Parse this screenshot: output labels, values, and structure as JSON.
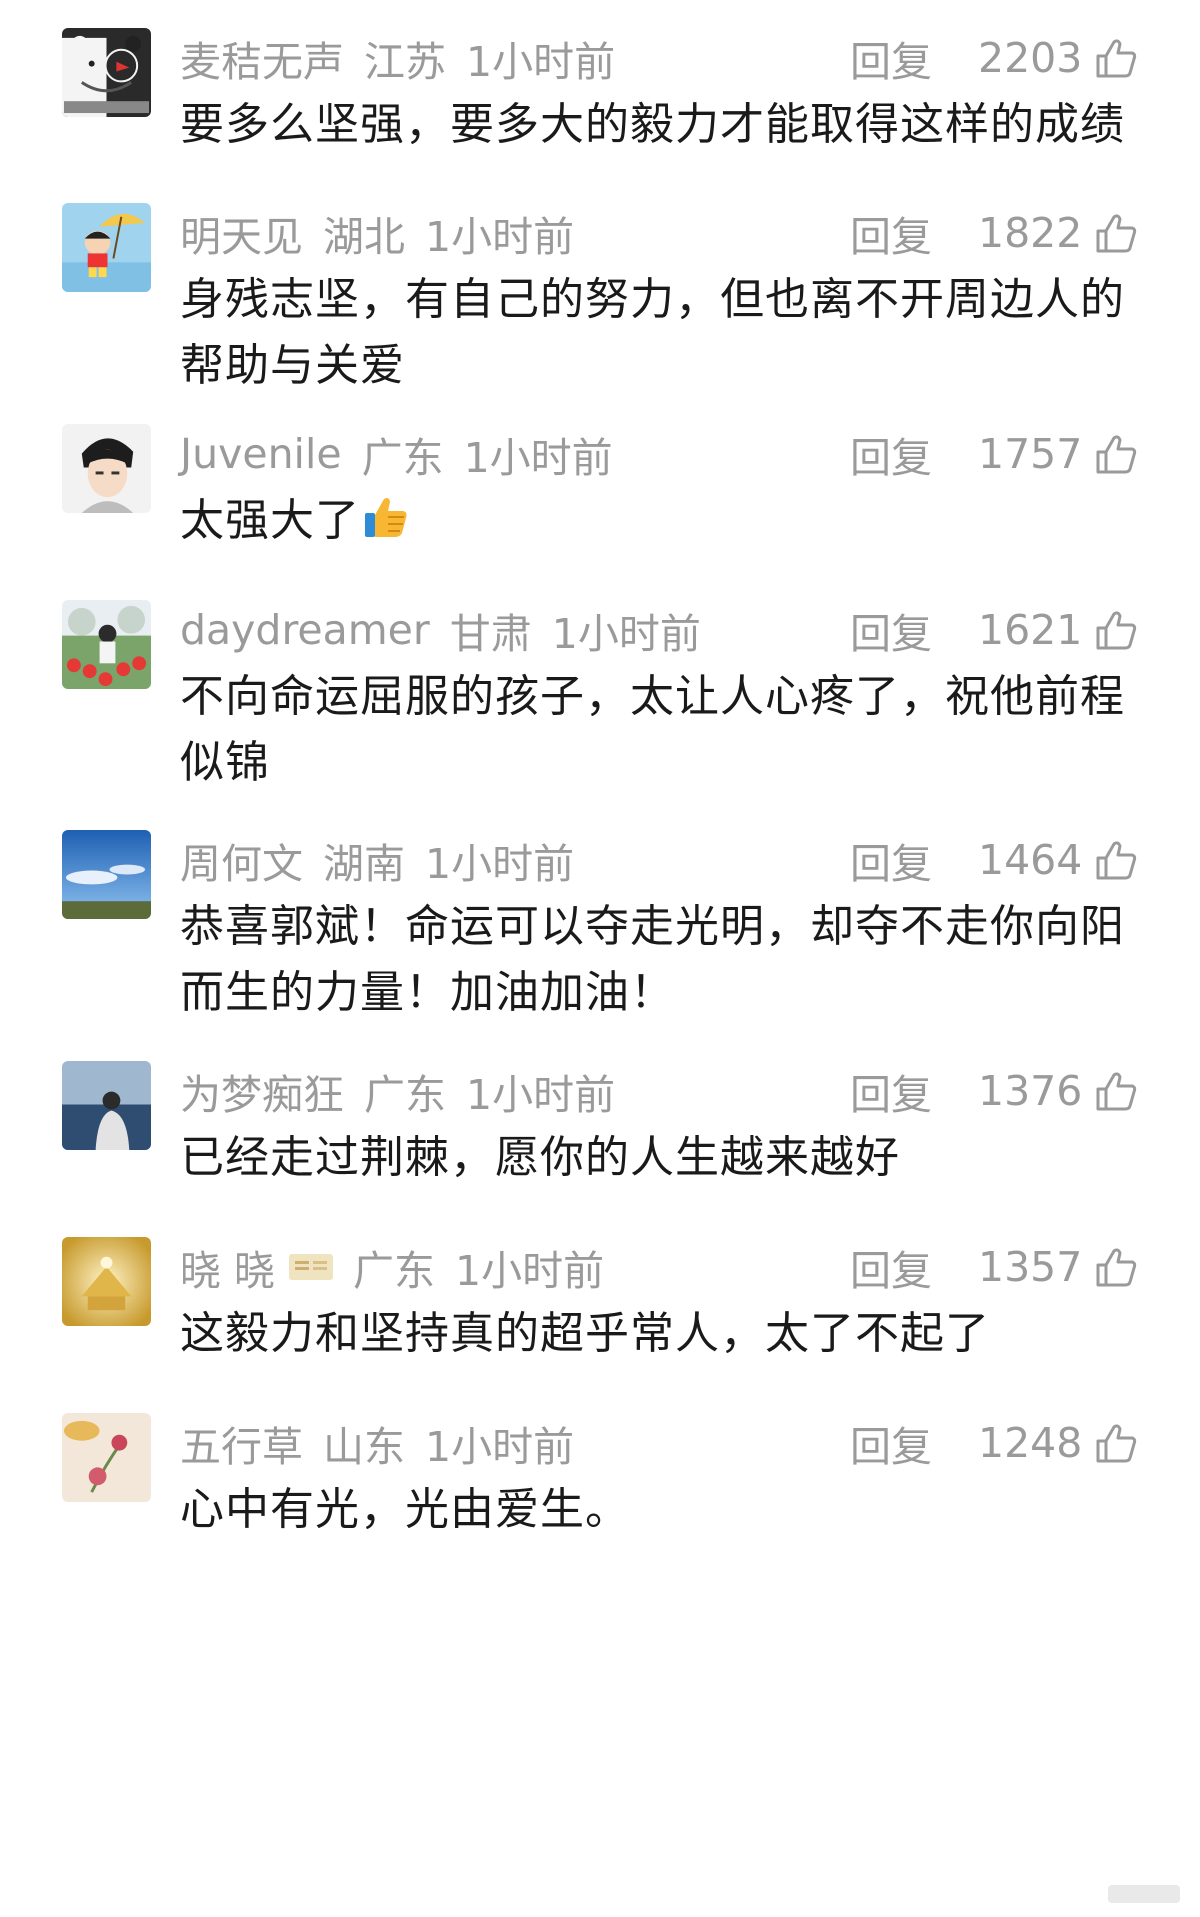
{
  "reply_label": "回复",
  "like_icon": "thumbs-up-outline-icon",
  "comments": [
    {
      "user": "麦秸无声",
      "region": "江苏",
      "time": "1小时前",
      "likes": "2203",
      "text": "要多么坚强，要多大的毅力才能取得这样的成绩"
    },
    {
      "user": "明天见",
      "region": "湖北",
      "time": "1小时前",
      "likes": "1822",
      "text": "身残志坚，有自己的努力，但也离不开周边人的帮助与关爱"
    },
    {
      "user": "Juvenile",
      "region": "广东",
      "time": "1小时前",
      "likes": "1757",
      "text": "太强大了",
      "emoji": "thumbs-up-emoji"
    },
    {
      "user": "daydreamer",
      "region": "甘肃",
      "time": "1小时前",
      "likes": "1621",
      "text": "不向命运屈服的孩子，太让人心疼了，祝他前程似锦"
    },
    {
      "user": "周何文",
      "region": "湖南",
      "time": "1小时前",
      "likes": "1464",
      "text": "恭喜郭斌！命运可以夺走光明，却夺不走你向阳而生的力量！加油加油！"
    },
    {
      "user": "为梦痴狂",
      "region": "广东",
      "time": "1小时前",
      "likes": "1376",
      "text": "已经走过荆棘，愿你的人生越来越好"
    },
    {
      "user": "晓 晓",
      "region": "广东",
      "time": "1小时前",
      "likes": "1357",
      "text": "这毅力和坚持真的超乎常人，太了不起了",
      "badge": "member-badge-icon"
    },
    {
      "user": "五行草",
      "region": "山东",
      "time": "1小时前",
      "likes": "1248",
      "text": "心中有光，光由爱生。"
    }
  ]
}
